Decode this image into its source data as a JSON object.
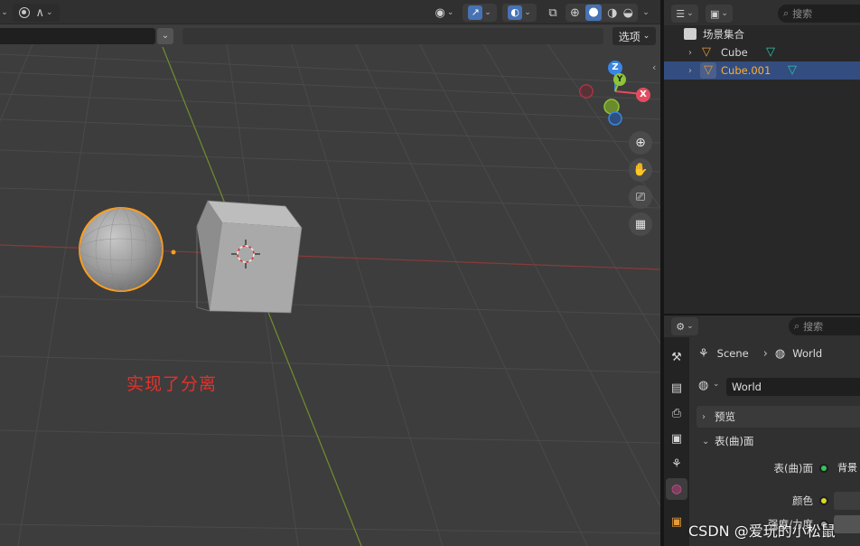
{
  "viewport": {
    "options_label": "选项",
    "annotation_text": "实现了分离",
    "header_icons": [
      "object-mode-icon",
      "proportional-edit-icon",
      "visibility-icon",
      "gizmo-icon",
      "overlay-icon",
      "xray-icon",
      "wireframe-shading-icon",
      "solid-shading-icon",
      "material-shading-icon",
      "rendered-shading-icon"
    ],
    "nav_gizmo_axes": [
      "X",
      "Y",
      "Z"
    ],
    "axis_colors": {
      "x": "#e34c5f",
      "y": "#8cc43a",
      "z": "#3b85e3"
    },
    "selection_color": "#ff9d1c",
    "nav_buttons": [
      "zoom-icon",
      "pan-hand-icon",
      "camera-icon",
      "grid-perspective-icon"
    ]
  },
  "outliner": {
    "search_placeholder": "搜索",
    "scene_collection_label": "场景集合",
    "items": [
      {
        "name": "Cube",
        "selected": false
      },
      {
        "name": "Cube.001",
        "selected": true
      }
    ]
  },
  "properties": {
    "search_placeholder": "搜索",
    "breadcrumb": {
      "scene": "Scene",
      "separator": "›",
      "world": "World"
    },
    "world_name": "World",
    "panels": {
      "preview": "预览",
      "surface": "表(曲)面"
    },
    "rows": {
      "surface_label": "表(曲)面",
      "surface_value": "背景",
      "color_label": "颜色",
      "strength_label": "强度/力度"
    }
  },
  "watermark": "CSDN @爱玩的小松鼠"
}
